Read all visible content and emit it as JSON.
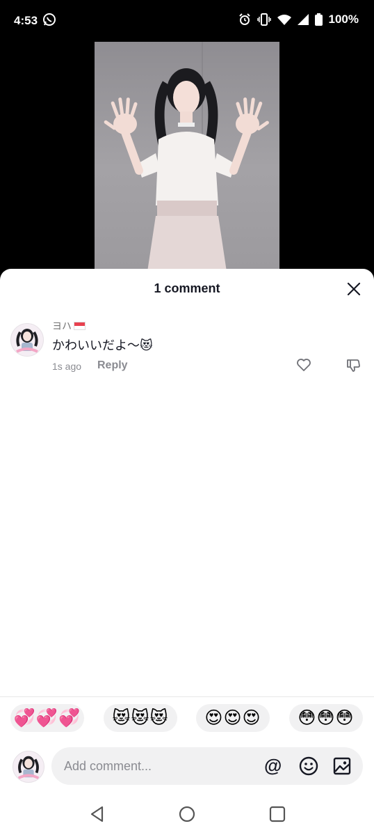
{
  "status_bar": {
    "time": "4:53",
    "battery": "100%",
    "icons": [
      "whatsapp-icon",
      "alarm-icon",
      "vibrate-icon",
      "wifi-icon",
      "signal-icon",
      "battery-icon"
    ]
  },
  "sheet": {
    "title": "1 comment"
  },
  "comment": {
    "username": "ヨハ",
    "text": "かわいいだよ〜😻",
    "time": "1s ago",
    "reply_label": "Reply"
  },
  "reactions": [
    "💞💞💞",
    "😻😻😻",
    "😍😍😍",
    "😳😳😳"
  ],
  "composer": {
    "placeholder": "Add comment...",
    "mention_symbol": "@"
  },
  "colors": {
    "text_primary": "#161823",
    "text_secondary": "#8a8b91",
    "chip_bg": "#f1f1f2",
    "flag_red": "#e8414f"
  }
}
